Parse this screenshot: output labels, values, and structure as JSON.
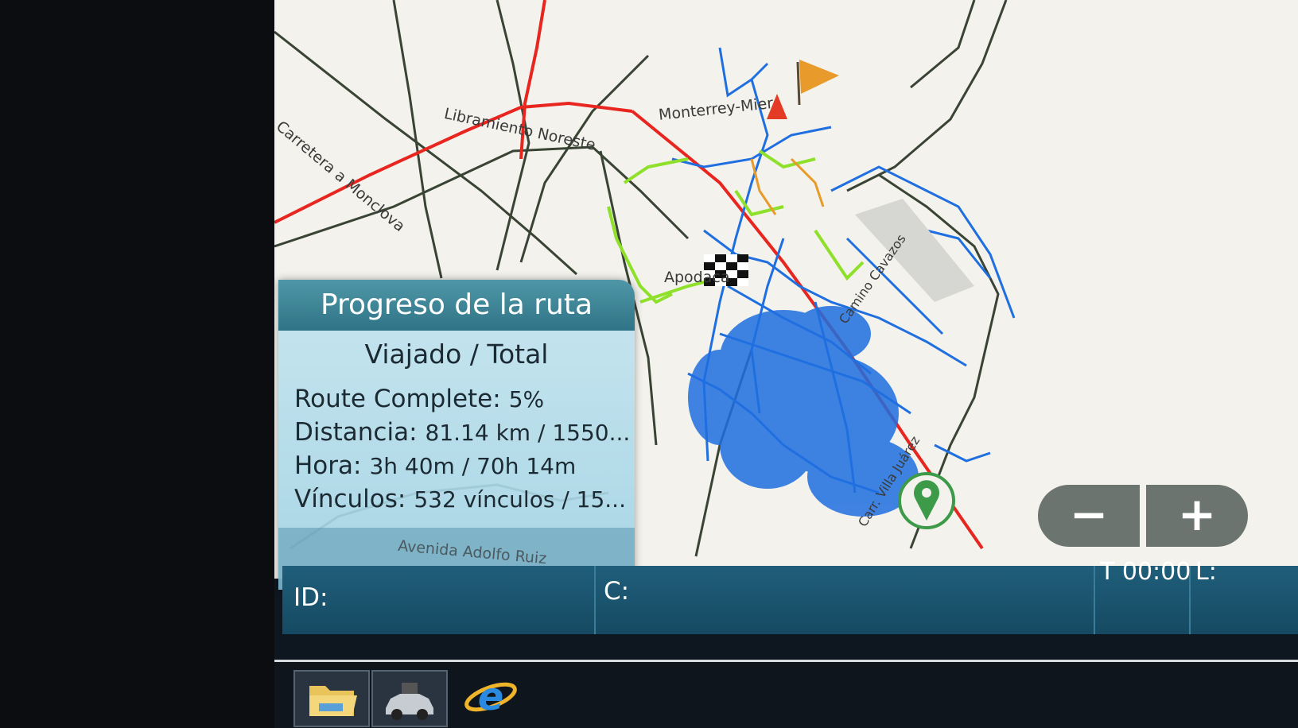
{
  "map": {
    "labels": {
      "carretera_monclova": "Carretera a Monclova",
      "libramiento": "Libramiento Noreste",
      "monterrey_mier": "Monterrey-Mier",
      "apodaca": "Apodaca",
      "camino_cavazos": "Camino Cavazos",
      "villa_juarez": "Carr. Villa Juárez",
      "adolfo_ruiz": "Avenida Adolfo Ruiz"
    },
    "colors": {
      "route_blue": "#1f6fe0",
      "route_green": "#8ee02a",
      "highway_red": "#e8251f",
      "road_dark": "#3a4434",
      "orange": "#e89a2a"
    }
  },
  "panel": {
    "title": "Progreso de la ruta",
    "subtitle": "Viajado / Total",
    "route_complete_label": "Route Complete:",
    "route_complete_value": "5%",
    "distancia_label": "Distancia:",
    "distancia_value": "81.14 km / 1550...",
    "hora_label": "Hora:",
    "hora_value": "3h 40m / 70h 14m",
    "vinculos_label": "Vínculos:",
    "vinculos_value": "532 vínculos / 15..."
  },
  "zoom": {
    "out_label": "−",
    "in_label": "+"
  },
  "statusbar": {
    "id_label": "ID:",
    "c_label": "C:",
    "time_label": "T 00:00",
    "l_label": "L:"
  },
  "taskbar": {
    "icons": [
      "folder-icon",
      "vehicle-app-icon",
      "internet-explorer-icon"
    ]
  }
}
